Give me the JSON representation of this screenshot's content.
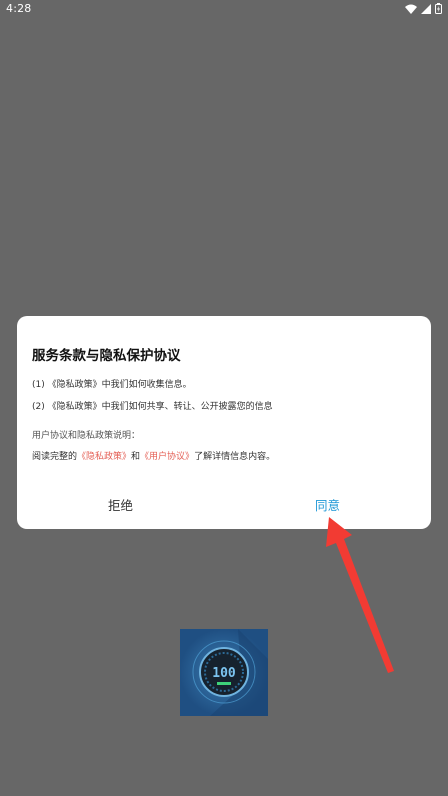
{
  "status_bar": {
    "time": "4:28"
  },
  "dialog": {
    "title": "服务条款与隐私保护协议",
    "line1": "(1) 《隐私政策》中我们如何收集信息。",
    "line2": "(2) 《隐私政策》中我们如何共享、转让、公开披露您的信息",
    "line3": "用户协议和隐私政策说明：",
    "line4_prefix": "阅读完整的",
    "privacy_link": "《隐私政策》",
    "line4_and": "和",
    "user_agreement_link": "《用户协议》",
    "line4_suffix": "了解详情信息内容。",
    "reject_label": "拒绝",
    "agree_label": "同意"
  },
  "arrow_color": "#f23b33",
  "app_icon": {
    "display_text": "100"
  }
}
